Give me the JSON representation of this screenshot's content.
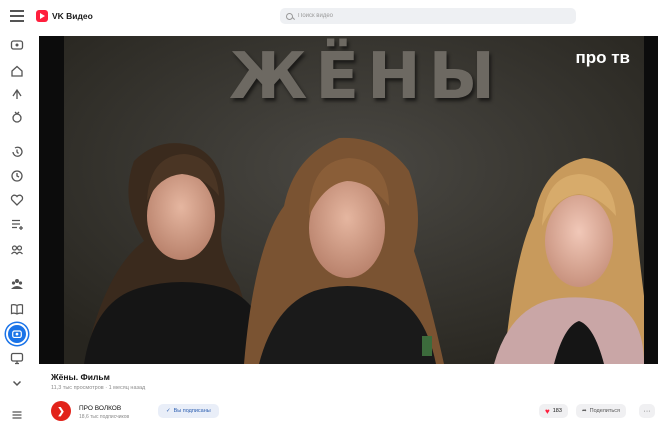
{
  "app": {
    "logo_text": "VK Видео"
  },
  "search": {
    "placeholder": "Поиск видео"
  },
  "video": {
    "overlay_title": "ЖЁНЫ",
    "channel_brand": "про тв",
    "title": "Жёны. Фильм",
    "stats": "11,3 тыс просмотров · 1 месяц назад"
  },
  "channel": {
    "name": "ПРО ВОЛКОВ",
    "subscribers": "18,6 тыс подписчиков",
    "subscribe_label": "Вы подписаны"
  },
  "actions": {
    "like_count": "183",
    "share_label": "Поделиться",
    "more_label": "···"
  },
  "colors": {
    "brand": "#ff1f3d",
    "accent": "#1a73e8"
  },
  "sidebar_icons": [
    "tv-icon",
    "home-icon",
    "trending-icon",
    "shorts-icon",
    "history-icon",
    "watch-later-icon",
    "liked-icon",
    "playlist-icon",
    "subscriptions-icon",
    "community-icon",
    "catalog-icon",
    "my-videos-icon",
    "screen-icon",
    "expand-icon",
    "menu-icon"
  ]
}
